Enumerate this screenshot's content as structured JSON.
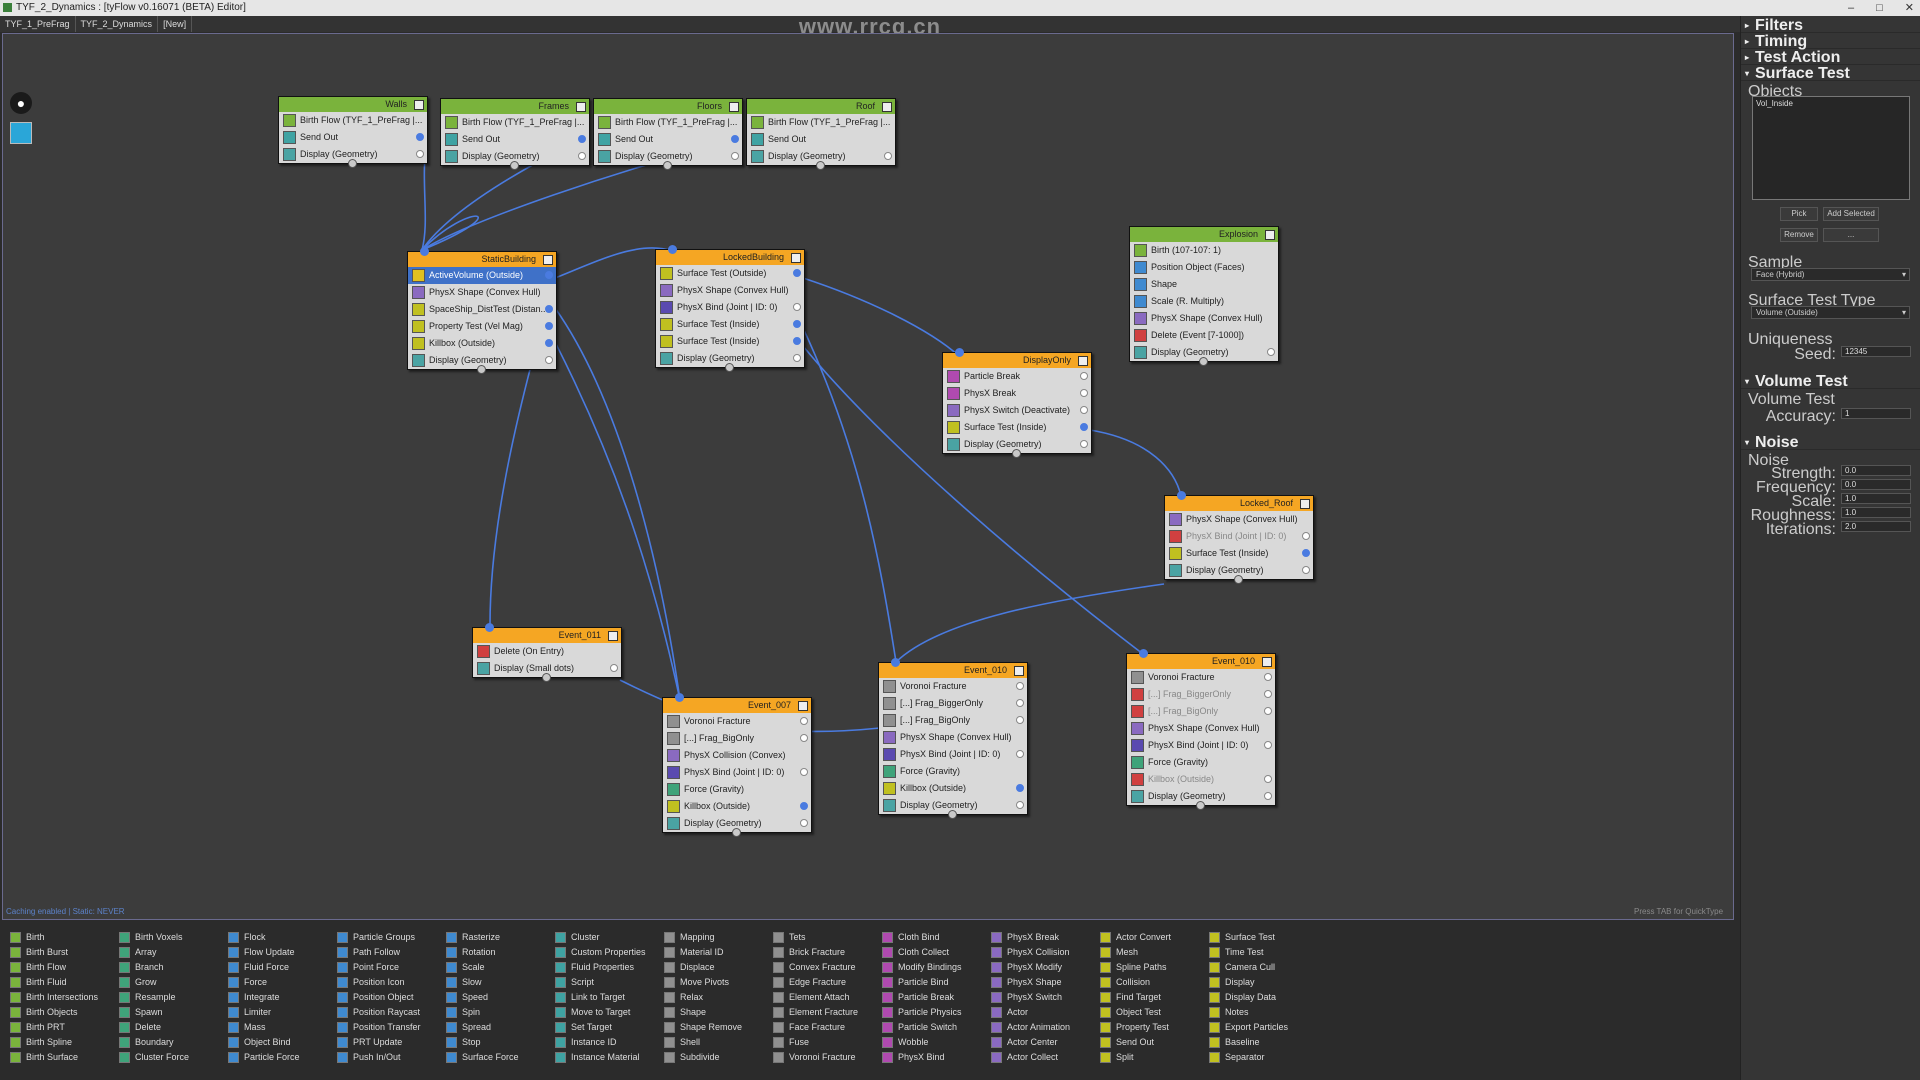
{
  "window": {
    "title": "TYF_2_Dynamics : [tyFlow v0.16071 (BETA) Editor]",
    "controls": [
      "–",
      "□",
      "✕"
    ]
  },
  "tabs": [
    "TYF_1_PreFrag",
    "TYF_2_Dynamics",
    "[New]"
  ],
  "watermark": "www.rrcg.cn",
  "colors": {
    "canvas_bg": "#3c3c3c",
    "header_green": "#7ab33c",
    "header_orange": "#f5a623",
    "wire_blue": "#4a7be0",
    "selected_op": "#3f71c8"
  },
  "nodes": [
    {
      "title": "Walls",
      "color": "green",
      "ops": [
        {
          "label": "Birth Flow (TYF_1_PreFrag |...",
          "icon": "#7ab33c"
        },
        {
          "label": "Send Out",
          "icon": "#3fa3a3",
          "port": "on"
        },
        {
          "label": "Display (Geometry)",
          "icon": "#4aa3a3",
          "port": "off"
        }
      ]
    },
    {
      "title": "Frames",
      "color": "green",
      "ops": [
        {
          "label": "Birth Flow (TYF_1_PreFrag |...",
          "icon": "#7ab33c"
        },
        {
          "label": "Send Out",
          "icon": "#3fa3a3",
          "port": "on"
        },
        {
          "label": "Display (Geometry)",
          "icon": "#4aa3a3",
          "port": "off"
        }
      ]
    },
    {
      "title": "Floors",
      "color": "green",
      "ops": [
        {
          "label": "Birth Flow (TYF_1_PreFrag |...",
          "icon": "#7ab33c"
        },
        {
          "label": "Send Out",
          "icon": "#3fa3a3",
          "port": "on"
        },
        {
          "label": "Display (Geometry)",
          "icon": "#4aa3a3",
          "port": "off"
        }
      ]
    },
    {
      "title": "Roof",
      "color": "green",
      "ops": [
        {
          "label": "Birth Flow (TYF_1_PreFrag |...",
          "icon": "#7ab33c"
        },
        {
          "label": "Send Out",
          "icon": "#3fa3a3"
        },
        {
          "label": "Display (Geometry)",
          "icon": "#4aa3a3",
          "port": "off"
        }
      ]
    },
    {
      "title": "StaticBuilding",
      "color": "orange",
      "ops": [
        {
          "label": "ActiveVolume (Outside)",
          "icon": "#e0c020",
          "port": "on",
          "selected": true
        },
        {
          "label": "PhysX Shape (Convex Hull)",
          "icon": "#8a6ac0"
        },
        {
          "label": "SpaceShip_DistTest (Distan...",
          "icon": "#c0c020",
          "port": "on"
        },
        {
          "label": "Property Test (Vel Mag)",
          "icon": "#c0c020",
          "port": "on"
        },
        {
          "label": "Killbox (Outside)",
          "icon": "#c0c020",
          "port": "on"
        },
        {
          "label": "Display (Geometry)",
          "icon": "#4aa3a3",
          "port": "off"
        }
      ]
    },
    {
      "title": "LockedBuilding",
      "color": "orange",
      "ops": [
        {
          "label": "Surface Test (Outside)",
          "icon": "#c0c020",
          "port": "on"
        },
        {
          "label": "PhysX Shape (Convex Hull)",
          "icon": "#8a6ac0"
        },
        {
          "label": "PhysX Bind (Joint | ID: 0)",
          "icon": "#5a4ab0",
          "port": "off"
        },
        {
          "label": "Surface Test (Inside)",
          "icon": "#c0c020",
          "port": "on"
        },
        {
          "label": "Surface Test (Inside)",
          "icon": "#c0c020",
          "port": "on"
        },
        {
          "label": "Display (Geometry)",
          "icon": "#4aa3a3",
          "port": "off"
        }
      ]
    },
    {
      "title": "DisplayOnly",
      "color": "orange",
      "ops": [
        {
          "label": "Particle Break",
          "icon": "#b04ab0",
          "port": "off"
        },
        {
          "label": "PhysX Break",
          "icon": "#b04ab0",
          "port": "off"
        },
        {
          "label": "PhysX Switch (Deactivate)",
          "icon": "#8a6ac0",
          "port": "off"
        },
        {
          "label": "Surface Test (Inside)",
          "icon": "#c0c020",
          "port": "on"
        },
        {
          "label": "Display (Geometry)",
          "icon": "#4aa3a3",
          "port": "off"
        }
      ]
    },
    {
      "title": "Explosion",
      "color": "green",
      "ops": [
        {
          "label": "Birth (107-107: 1)",
          "icon": "#7ab33c"
        },
        {
          "label": "Position Object (Faces)",
          "icon": "#3f8ad0"
        },
        {
          "label": "Shape",
          "icon": "#3f8ad0"
        },
        {
          "label": "Scale (R. Multiply)",
          "icon": "#3f8ad0"
        },
        {
          "label": "PhysX Shape (Convex Hull)",
          "icon": "#8a6ac0"
        },
        {
          "label": "Delete (Event [7-1000])",
          "icon": "#d04040"
        },
        {
          "label": "Display (Geometry)",
          "icon": "#4aa3a3",
          "port": "off"
        }
      ]
    },
    {
      "title": "Locked_Roof",
      "color": "orange",
      "ops": [
        {
          "label": "PhysX Shape (Convex Hull)",
          "icon": "#8a6ac0"
        },
        {
          "label": "PhysX Bind (Joint | ID: 0)",
          "icon": "#d04040",
          "port": "off",
          "disabled": true
        },
        {
          "label": "Surface Test (Inside)",
          "icon": "#c0c020",
          "port": "on"
        },
        {
          "label": "Display (Geometry)",
          "icon": "#4aa3a3",
          "port": "off"
        }
      ]
    },
    {
      "title": "Event_011",
      "color": "orange",
      "ops": [
        {
          "label": "Delete (On Entry)",
          "icon": "#d04040"
        },
        {
          "label": "Display (Small dots)",
          "icon": "#4aa3a3",
          "port": "off"
        }
      ]
    },
    {
      "title": "Event_007",
      "color": "orange",
      "ops": [
        {
          "label": "Voronoi Fracture",
          "icon": "#909090",
          "port": "off"
        },
        {
          "label": "[...] Frag_BigOnly",
          "icon": "#909090",
          "port": "off"
        },
        {
          "label": "PhysX Collision (Convex)",
          "icon": "#8a6ac0"
        },
        {
          "label": "PhysX Bind (Joint | ID: 0)",
          "icon": "#5a4ab0",
          "port": "off"
        },
        {
          "label": "Force (Gravity)",
          "icon": "#3fa37a"
        },
        {
          "label": "Killbox (Outside)",
          "icon": "#c0c020",
          "port": "on"
        },
        {
          "label": "Display (Geometry)",
          "icon": "#4aa3a3",
          "port": "off"
        }
      ]
    },
    {
      "title": "Event_010",
      "color": "orange",
      "ops": [
        {
          "label": "Voronoi Fracture",
          "icon": "#909090",
          "port": "off"
        },
        {
          "label": "[...] Frag_BiggerOnly",
          "icon": "#909090",
          "port": "off"
        },
        {
          "label": "[...] Frag_BigOnly",
          "icon": "#909090",
          "port": "off"
        },
        {
          "label": "PhysX Shape (Convex Hull)",
          "icon": "#8a6ac0"
        },
        {
          "label": "PhysX Bind (Joint | ID: 0)",
          "icon": "#5a4ab0",
          "port": "off"
        },
        {
          "label": "Force (Gravity)",
          "icon": "#3fa37a"
        },
        {
          "label": "Killbox (Outside)",
          "icon": "#c0c020",
          "port": "on"
        },
        {
          "label": "Display (Geometry)",
          "icon": "#4aa3a3",
          "port": "off"
        }
      ]
    },
    {
      "title": "Event_010",
      "color": "orange",
      "ops": [
        {
          "label": "Voronoi Fracture",
          "icon": "#909090",
          "port": "off"
        },
        {
          "label": "[...] Frag_BiggerOnly",
          "icon": "#d04040",
          "port": "off",
          "disabled": true
        },
        {
          "label": "[...] Frag_BigOnly",
          "icon": "#d04040",
          "port": "off",
          "disabled": true
        },
        {
          "label": "PhysX Shape (Convex Hull)",
          "icon": "#8a6ac0"
        },
        {
          "label": "PhysX Bind (Joint | ID: 0)",
          "icon": "#5a4ab0",
          "port": "off"
        },
        {
          "label": "Force (Gravity)",
          "icon": "#3fa37a"
        },
        {
          "label": "Killbox (Outside)",
          "icon": "#d04040",
          "port": "off",
          "disabled": true
        },
        {
          "label": "Display (Geometry)",
          "icon": "#4aa3a3",
          "port": "off"
        }
      ]
    }
  ],
  "status": {
    "left": "Caching enabled | Static: NEVER",
    "right": "Press TAB for QuickType"
  },
  "palette": [
    [
      "Birth",
      "Birth Burst",
      "Birth Flow",
      "Birth Fluid",
      "Birth Intersections",
      "Birth Objects",
      "Birth PRT",
      "Birth Spline",
      "Birth Surface"
    ],
    [
      "Birth Voxels",
      "Array",
      "Branch",
      "Grow",
      "Resample",
      "Spawn",
      "Delete",
      "Boundary",
      "Cluster Force"
    ],
    [
      "Flock",
      "Flow Update",
      "Fluid Force",
      "Force",
      "Integrate",
      "Limiter",
      "Mass",
      "Object Bind",
      "Particle Force"
    ],
    [
      "Particle Groups",
      "Path Follow",
      "Point Force",
      "Position Icon",
      "Position Object",
      "Position Raycast",
      "Position Transfer",
      "PRT Update",
      "Push In/Out"
    ],
    [
      "Rasterize",
      "Rotation",
      "Scale",
      "Slow",
      "Speed",
      "Spin",
      "Spread",
      "Stop",
      "Surface Force"
    ],
    [
      "Cluster",
      "Custom Properties",
      "Fluid Properties",
      "Script",
      "Link to Target",
      "Move to Target",
      "Set Target",
      "Instance ID",
      "Instance Material"
    ],
    [
      "Mapping",
      "Material ID",
      "Displace",
      "Move Pivots",
      "Relax",
      "Shape",
      "Shape Remove",
      "Shell",
      "Subdivide"
    ],
    [
      "Tets",
      "Brick Fracture",
      "Convex Fracture",
      "Edge Fracture",
      "Element Attach",
      "Element Fracture",
      "Face Fracture",
      "Fuse",
      "Voronoi Fracture"
    ],
    [
      "Cloth Bind",
      "Cloth Collect",
      "Modify Bindings",
      "Particle Bind",
      "Particle Break",
      "Particle Physics",
      "Particle Switch",
      "Wobble",
      "PhysX Bind"
    ],
    [
      "PhysX Break",
      "PhysX Collision",
      "PhysX Modify",
      "PhysX Shape",
      "PhysX Switch",
      "Actor",
      "Actor Animation",
      "Actor Center",
      "Actor Collect"
    ],
    [
      "Actor Convert",
      "Mesh",
      "Spline Paths",
      "Collision",
      "Find Target",
      "Object Test",
      "Property Test",
      "Send Out",
      "Split"
    ],
    [
      "Surface Test",
      "Time Test",
      "Camera Cull",
      "Display",
      "Display Data",
      "Notes",
      "Export Particles",
      "Baseline",
      "Separator"
    ]
  ],
  "palette_colors": [
    "#7ab33c",
    "#3fa37a",
    "#3f8ad0",
    "#3f8ad0",
    "#3f8ad0",
    "#3fa3a3",
    "#909090",
    "#909090",
    "#b04ab0",
    "#8a6ac0",
    "#c0c020",
    "#c0c020"
  ],
  "panel": {
    "sections": [
      "Filters",
      "Timing",
      "Test Action",
      "Surface Test",
      "Volume Test",
      "Noise"
    ],
    "objects_label": "Objects",
    "objects": [
      "Vol_Inside"
    ],
    "buttons": [
      "Pick",
      "Add Selected",
      "Remove",
      "..."
    ],
    "sample_label": "Sample",
    "sample_value": "Face (Hybrid)",
    "surface_test_type_label": "Surface Test Type",
    "surface_test_type_value": "Volume (Outside)",
    "uniqueness_label": "Uniqueness",
    "seed_label": "Seed:",
    "seed_value": "12345",
    "volume_test_label": "Volume Test",
    "accuracy_label": "Accuracy:",
    "accuracy_value": "1",
    "noise_label": "Noise",
    "noise_fields": [
      {
        "label": "Strength:",
        "value": "0.0"
      },
      {
        "label": "Frequency:",
        "value": "0.0"
      },
      {
        "label": "Scale:",
        "value": "1.0"
      },
      {
        "label": "Roughness:",
        "value": "1.0"
      },
      {
        "label": "Iterations:",
        "value": "2.0"
      }
    ]
  }
}
